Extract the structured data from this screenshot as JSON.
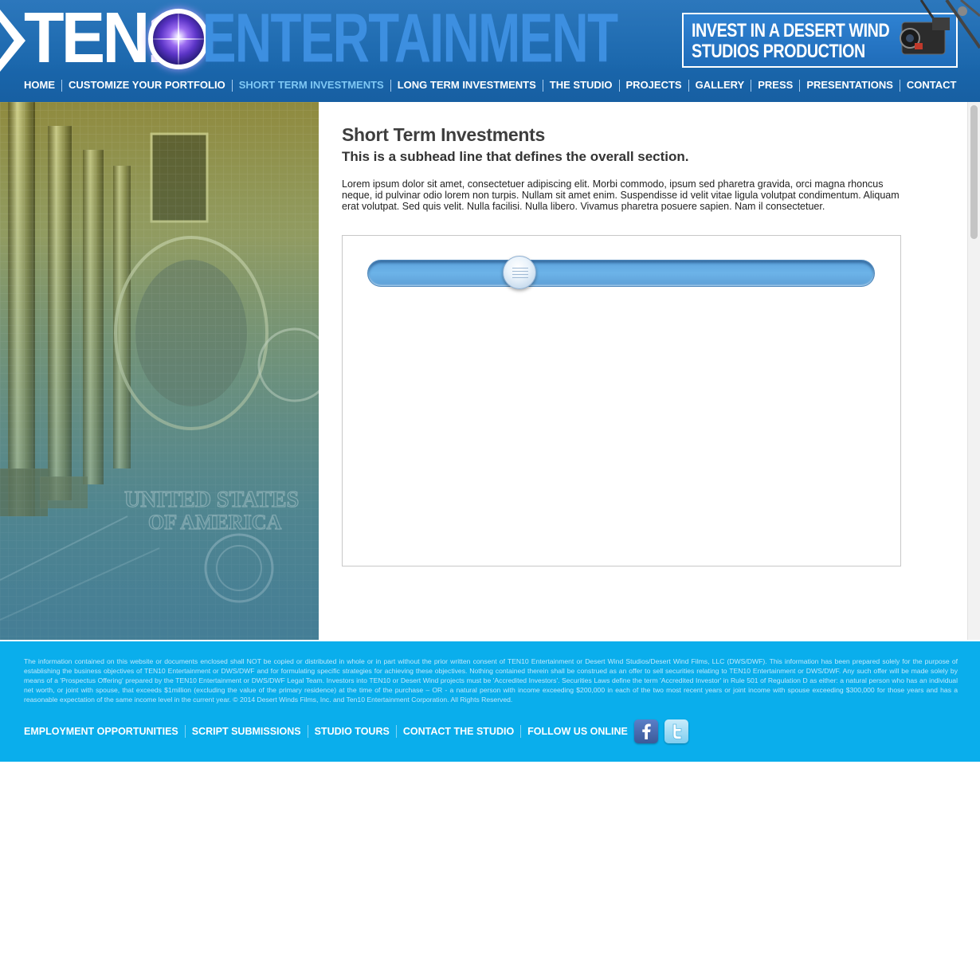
{
  "header": {
    "logo": {
      "ten": "TEN1",
      "entertainment": "ENTERTAINMENT"
    },
    "banner": {
      "line1": "INVEST IN A DESERT WIND",
      "line2": "STUDIOS PRODUCTION"
    },
    "nav": [
      {
        "label": "HOME",
        "active": false
      },
      {
        "label": "CUSTOMIZE YOUR PORTFOLIO",
        "active": false
      },
      {
        "label": "SHORT TERM INVESTMENTS",
        "active": true
      },
      {
        "label": "LONG TERM INVESTMENTS",
        "active": false
      },
      {
        "label": "THE STUDIO",
        "active": false
      },
      {
        "label": "PROJECTS",
        "active": false
      },
      {
        "label": "GALLERY",
        "active": false
      },
      {
        "label": "PRESS",
        "active": false
      },
      {
        "label": "PRESENTATIONS",
        "active": false
      },
      {
        "label": "CONTACT",
        "active": false
      }
    ]
  },
  "main": {
    "title": "Short Term Investments",
    "subhead": "This is a subhead line that defines the overall section.",
    "body": "Lorem ipsum dolor sit amet, consectetuer adipiscing elit. Morbi commodo, ipsum sed pharetra gravida, orci magna rhoncus neque, id pulvinar odio lorem non turpis. Nullam sit amet enim. Suspendisse id velit vitae ligula volutpat condimentum. Aliquam erat volutpat. Sed quis velit. Nulla facilisi. Nulla libero. Vivamus pharetra posuere sapien. Nam il consectetuer.",
    "slider": {
      "value_fraction": 0.285
    }
  },
  "hero_image": {
    "alt": ""
  },
  "footer": {
    "disclaimer": "The information contained on this website or documents enclosed shall NOT be copied or distributed in whole or in part without the prior written consent of TEN10 Entertainment or Desert Wind Studios/Desert Wind Films, LLC (DWS/DWF).  This information has been prepared solely for the purpose of establishing the business objectives of TEN10 Entertainment or DWS/DWF and for formulating specific strategies for achieving these objectives. Nothing contained therein shall be construed as an offer to sell securities relating to TEN10 Entertainment or DWS/DWF.  Any such offer will be made solely by means of a 'Prospectus Offering' prepared by the TEN10 Entertainment or DWS/DWF Legal Team. Investors into TEN10 or Desert Wind projects must be 'Accredited Investors'. Securities Laws define the term 'Accredited Investor' in Rule 501 of Regulation D as either: a natural person who has an individual net worth, or joint with spouse, that exceeds $1million (excluding the value of the primary residence) at the time of the purchase – OR - a natural person with income exceeding $200,000 in each of the two most recent years or joint income with spouse exceeding $300,000 for those years and has a reasonable expectation of the same income level in the current year.    © 2014 Desert Winds Films, Inc. and Ten10 Entertainment Corporation. All Rights Reserved.",
    "nav": [
      {
        "label": "EMPLOYMENT OPPORTUNITIES"
      },
      {
        "label": "SCRIPT SUBMISSIONS"
      },
      {
        "label": "STUDIO TOURS"
      },
      {
        "label": "CONTACT THE STUDIO"
      }
    ],
    "follow_label": "FOLLOW US ONLINE",
    "social": [
      {
        "icon": "facebook-icon",
        "glyph": "f"
      },
      {
        "icon": "twitter-icon",
        "glyph": "t"
      }
    ]
  },
  "colors": {
    "header_blue": "#1a67ad",
    "nav_active": "#7fc8f5",
    "footer_blue": "#0aaeec",
    "slider_track": "#6cb3e8"
  }
}
